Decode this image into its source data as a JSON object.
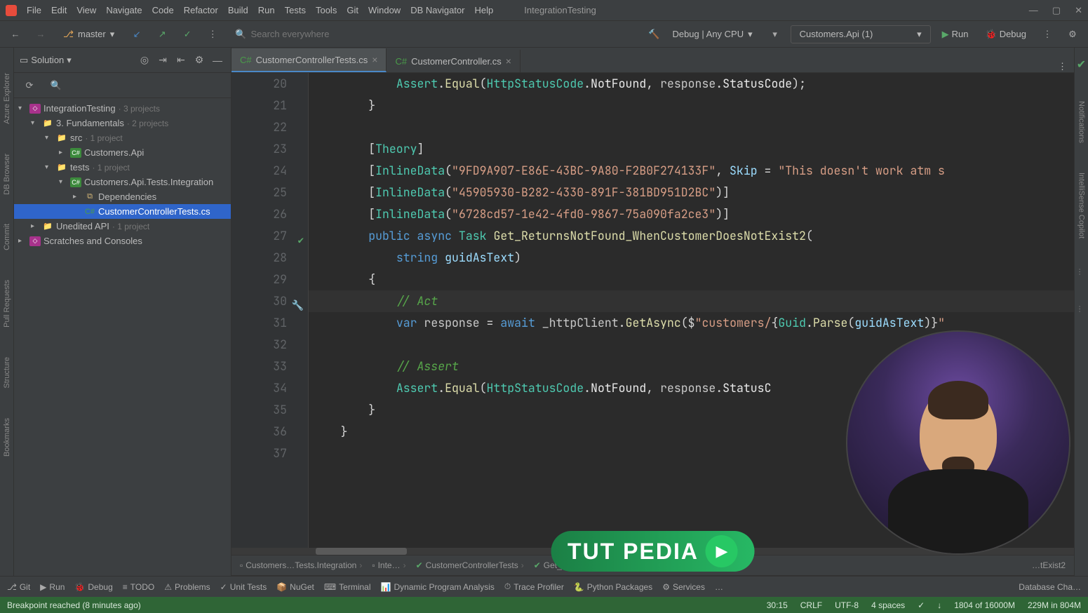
{
  "menus": [
    "File",
    "Edit",
    "View",
    "Navigate",
    "Code",
    "Refactor",
    "Build",
    "Run",
    "Tests",
    "Tools",
    "Git",
    "Window",
    "DB Navigator",
    "Help"
  ],
  "project_title": "IntegrationTesting",
  "branch": "master",
  "search_placeholder": "Search everywhere",
  "config": {
    "label": "Debug | Any CPU",
    "run_config": "Customers.Api (1)",
    "run": "Run",
    "debug": "Debug"
  },
  "sidebar": {
    "title": "Solution",
    "tree": [
      {
        "indent": 0,
        "chev": "▾",
        "icon": "sln",
        "label": "IntegrationTesting",
        "hint": "· 3 projects"
      },
      {
        "indent": 1,
        "chev": "▾",
        "icon": "folder",
        "label": "3. Fundamentals",
        "hint": "· 2 projects"
      },
      {
        "indent": 2,
        "chev": "▾",
        "icon": "folder",
        "label": "src",
        "hint": "· 1 project"
      },
      {
        "indent": 3,
        "chev": "▸",
        "icon": "csproj",
        "label": "Customers.Api",
        "hint": ""
      },
      {
        "indent": 2,
        "chev": "▾",
        "icon": "folder",
        "label": "tests",
        "hint": "· 1 project"
      },
      {
        "indent": 3,
        "chev": "▾",
        "icon": "csproj",
        "label": "Customers.Api.Tests.Integration",
        "hint": ""
      },
      {
        "indent": 4,
        "chev": "▸",
        "icon": "dep",
        "label": "Dependencies",
        "hint": ""
      },
      {
        "indent": 4,
        "chev": "",
        "icon": "cs",
        "label": "CustomerControllerTests.cs",
        "hint": "",
        "active": true
      },
      {
        "indent": 1,
        "chev": "▸",
        "icon": "folder",
        "label": "Unedited API",
        "hint": "· 1 project"
      },
      {
        "indent": 0,
        "chev": "▸",
        "icon": "sln",
        "label": "Scratches and Consoles",
        "hint": ""
      }
    ]
  },
  "left_tabs": [
    "Azure Explorer",
    "DB Browser",
    "Commit",
    "Pull Requests",
    "Structure",
    "Bookmarks"
  ],
  "right_tabs": [
    "Notifications",
    "IntelliSense Copilot",
    "…",
    "…"
  ],
  "tabs": [
    {
      "icon": "C#",
      "label": "CustomerControllerTests.cs",
      "active": true
    },
    {
      "icon": "C#",
      "label": "CustomerController.cs",
      "active": false
    }
  ],
  "code": {
    "start": 20,
    "lines": [
      {
        "n": 20,
        "html": "            <span class='k-type'>Assert</span><span class='k-punc'>.</span><span class='k-func'>Equal</span><span class='k-punc'>(</span><span class='k-type'>HttpStatusCode</span><span class='k-punc'>.</span><span class='k-white'>NotFound</span><span class='k-punc'>, </span><span class='k-local'>response</span><span class='k-punc'>.</span><span class='k-white'>StatusCode</span><span class='k-punc'>);</span>"
      },
      {
        "n": 21,
        "html": "        <span class='k-punc'>}</span>"
      },
      {
        "n": 22,
        "html": ""
      },
      {
        "n": 23,
        "html": "        <span class='k-punc'>[</span><span class='k-type'>Theory</span><span class='k-punc'>]</span>"
      },
      {
        "n": 24,
        "html": "        <span class='k-punc'>[</span><span class='k-type'>InlineData</span><span class='k-punc'>(</span><span class='k-str'>\"9FD9A907-E86E-43BC-9A80-F2B0F274133F\"</span><span class='k-punc'>, </span><span class='k-param'>Skip</span><span class='k-punc'> = </span><span class='k-str'>\"This doesn't work atm s</span>"
      },
      {
        "n": 25,
        "html": "        <span class='k-punc'>[</span><span class='k-type'>InlineData</span><span class='k-punc'>(</span><span class='k-str'>\"45905930-B282-4330-891F-381BD951D2BC\"</span><span class='k-punc'>)]</span>"
      },
      {
        "n": 26,
        "html": "        <span class='k-punc'>[</span><span class='k-type'>InlineData</span><span class='k-punc'>(</span><span class='k-str'>\"6728cd57-1e42-4fd0-9867-75a090fa2ce3\"</span><span class='k-punc'>)]</span>"
      },
      {
        "n": 27,
        "mark": "check",
        "html": "        <span class='k-blue'>public</span> <span class='k-blue'>async</span> <span class='k-type'>Task</span> <span class='k-func'>Get_ReturnsNotFound_WhenCustomerDoesNotExist2</span><span class='k-punc'>(</span>"
      },
      {
        "n": 28,
        "html": "            <span class='k-blue'>string</span> <span class='k-param'>guidAsText</span><span class='k-punc'>)</span>"
      },
      {
        "n": 29,
        "html": "        <span class='k-punc'>{</span>"
      },
      {
        "n": 30,
        "mark": "hammer",
        "current": true,
        "html": "            <span class='k-comment'>// Act</span>"
      },
      {
        "n": 31,
        "html": "            <span class='k-blue'>var</span> <span class='k-local'>response</span> <span class='k-punc'>=</span> <span class='k-blue'>await</span> <span class='k-local'>_httpClient</span><span class='k-punc'>.</span><span class='k-func'>GetAsync</span><span class='k-punc'>($</span><span class='k-str'>\"customers/</span><span class='k-punc'>{</span><span class='k-type'>Guid</span><span class='k-punc'>.</span><span class='k-func'>Parse</span><span class='k-punc'>(</span><span class='k-param'>guidAsText</span><span class='k-punc'>)}</span><span class='k-str'>\"</span>"
      },
      {
        "n": 32,
        "html": ""
      },
      {
        "n": 33,
        "html": "            <span class='k-comment'>// Assert</span>"
      },
      {
        "n": 34,
        "html": "            <span class='k-type'>Assert</span><span class='k-punc'>.</span><span class='k-func'>Equal</span><span class='k-punc'>(</span><span class='k-type'>HttpStatusCode</span><span class='k-punc'>.</span><span class='k-white'>NotFound</span><span class='k-punc'>, </span><span class='k-local'>response</span><span class='k-punc'>.</span><span class='k-white'>StatusC</span>"
      },
      {
        "n": 35,
        "html": "        <span class='k-punc'>}</span>"
      },
      {
        "n": 36,
        "html": "    <span class='k-punc'>}</span>"
      },
      {
        "n": 37,
        "html": ""
      }
    ]
  },
  "breadcrumb": [
    {
      "icon": "cs",
      "label": "Customers…Tests.Integration"
    },
    {
      "icon": "ns",
      "label": "Inte…"
    },
    {
      "icon": "pass",
      "label": "CustomerControllerTests"
    },
    {
      "icon": "pass",
      "label": "Get_Retu…"
    }
  ],
  "breadcrumb_right": "…tExist2",
  "bottom_tabs": [
    "Git",
    "Run",
    "Debug",
    "TODO",
    "Problems",
    "Unit Tests",
    "NuGet",
    "Terminal",
    "Dynamic Program Analysis",
    "Trace Profiler",
    "Python Packages",
    "Services",
    "…",
    "Database Cha…"
  ],
  "status": {
    "left": "Breakpoint reached (8 minutes ago)",
    "items": [
      "30:15",
      "CRLF",
      "UTF-8",
      "4 spaces",
      "✓",
      "↓",
      "1804 of 16000M",
      "229M in 804M"
    ]
  },
  "logo": {
    "t1": "TUT",
    "t2": "PEDIA"
  }
}
